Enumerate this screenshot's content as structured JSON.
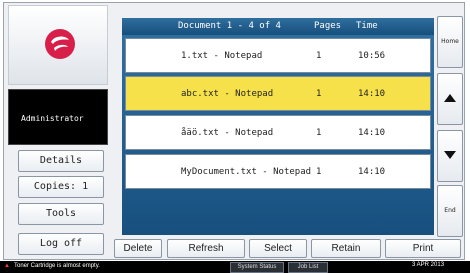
{
  "user": {
    "name": "Administrator"
  },
  "sidebar": {
    "details": "Details",
    "copies": "Copies: 1",
    "tools": "Tools",
    "logoff": "Log off"
  },
  "list": {
    "header": {
      "title": "Document 1 - 4 of 4",
      "pages": "Pages",
      "time": "Time"
    },
    "rows": [
      {
        "name": "1.txt - Notepad",
        "pages": "1",
        "time": "10:56",
        "selected": false
      },
      {
        "name": "abc.txt - Notepad",
        "pages": "1",
        "time": "14:10",
        "selected": true
      },
      {
        "name": "åäö.txt - Notepad",
        "pages": "1",
        "time": "14:10",
        "selected": false
      },
      {
        "name": "MyDocument.txt - Notepad",
        "pages": "1",
        "time": "14:10",
        "selected": false
      }
    ]
  },
  "nav": {
    "home": "Home",
    "end": "End"
  },
  "actions": {
    "delete": "Delete",
    "refresh": "Refresh",
    "select": "Select",
    "retain": "Retain",
    "print": "Print"
  },
  "status": {
    "message": "Toner Cartridge is almost empty.",
    "system_status": "System Status",
    "job_list": "Job List",
    "date": "3 APR  2013"
  },
  "colors": {
    "selected_row": "#f7e14a",
    "list_bg": "#1f5f91",
    "logo": "#d81f4a"
  }
}
